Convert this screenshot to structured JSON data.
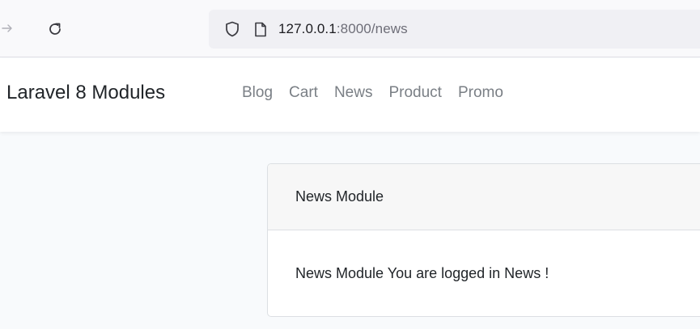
{
  "browser": {
    "url_host": "127.0.0.1",
    "url_rest": ":8000/news",
    "icons": [
      "forward-arrow-icon",
      "reload-icon",
      "shield-icon",
      "page-icon"
    ]
  },
  "navbar": {
    "brand": "Laravel 8 Modules",
    "links": [
      {
        "label": "Blog"
      },
      {
        "label": "Cart"
      },
      {
        "label": "News"
      },
      {
        "label": "Product"
      },
      {
        "label": "Promo"
      }
    ]
  },
  "card": {
    "header": "News Module",
    "body": "News Module You are logged in News !"
  },
  "colors": {
    "page_background": "#f8fafc",
    "nav_link": "#7a7f85",
    "card_header_bg": "#f7f7f7",
    "text": "#212529"
  }
}
